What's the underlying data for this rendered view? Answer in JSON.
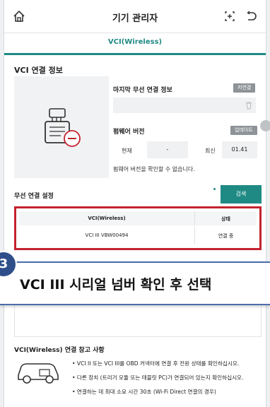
{
  "header": {
    "title": "기기 관리자"
  },
  "tab": {
    "label": "VCI(Wireless)"
  },
  "connection_info": {
    "section_title": "VCI 연결 정보",
    "last_wireless_label": "마지막 무선 연결 정보",
    "release_button": "저연결",
    "firmware_label": "펌웨어 버전",
    "update_button": "업데이트",
    "current_label": "현재",
    "current_value": "-",
    "latest_label": "최신",
    "latest_value": "01.41",
    "firmware_note": "펌웨어 버전을 확인할 수 없습니다."
  },
  "wireless_setup": {
    "title": "무선 연결 설정",
    "scan_button": "검색"
  },
  "vci_table": {
    "columns": [
      "VCI(Wireless)",
      "상태"
    ],
    "rows": [
      {
        "vci": "VCI III VBW00494",
        "status": "연결 중"
      }
    ]
  },
  "callout": {
    "step": "3",
    "text": "VCI III 시리얼 넘버 확인 후 선택"
  },
  "reference": {
    "title": "VCI(Wireless) 연결 참고 사항",
    "bullets": [
      "• VCI II 또는 VCI III를 OBD 커넥터에 연결 후 전원 상태를 확인하십시오.",
      "• 다른 장치 (트리거 모듈 또는 태블릿 PC)가 연결되어 있는지 확인하십시오.",
      "• 연결하는 데 최대 소요 시간 30초 (Wi-Fi Direct 연결의 경우)"
    ]
  },
  "colors": {
    "accent": "#1f8a84",
    "highlight": "#c4222f",
    "callout": "#2f4f8a"
  }
}
